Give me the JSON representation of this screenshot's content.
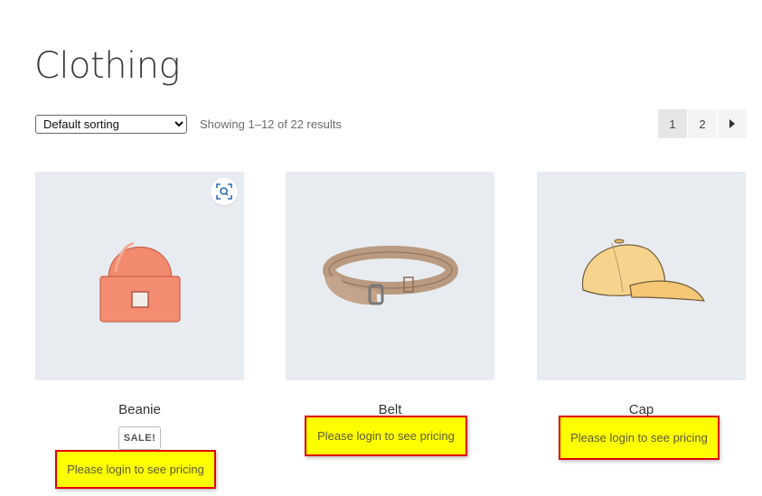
{
  "page": {
    "title": "Clothing",
    "sorting": {
      "selected": "Default sorting",
      "options": [
        "Default sorting"
      ]
    },
    "result_count": "Showing 1–12 of 22 results",
    "pagination": {
      "pages": [
        "1",
        "2"
      ],
      "current": "1",
      "next_icon": "triangle-right"
    }
  },
  "products": [
    {
      "name": "Beanie",
      "sale_badge": "SALE!",
      "pricing_notice": "Please login to see pricing",
      "image": "beanie"
    },
    {
      "name": "Belt",
      "pricing_notice": "Please login to see pricing",
      "image": "belt"
    },
    {
      "name": "Cap",
      "pricing_notice": "Please login to see pricing",
      "image": "cap"
    }
  ],
  "colors": {
    "notice_bg": "#ffff00",
    "notice_border": "#e10000",
    "image_bg": "#e8ecf0",
    "zoom_icon": "#2f6fb5"
  }
}
